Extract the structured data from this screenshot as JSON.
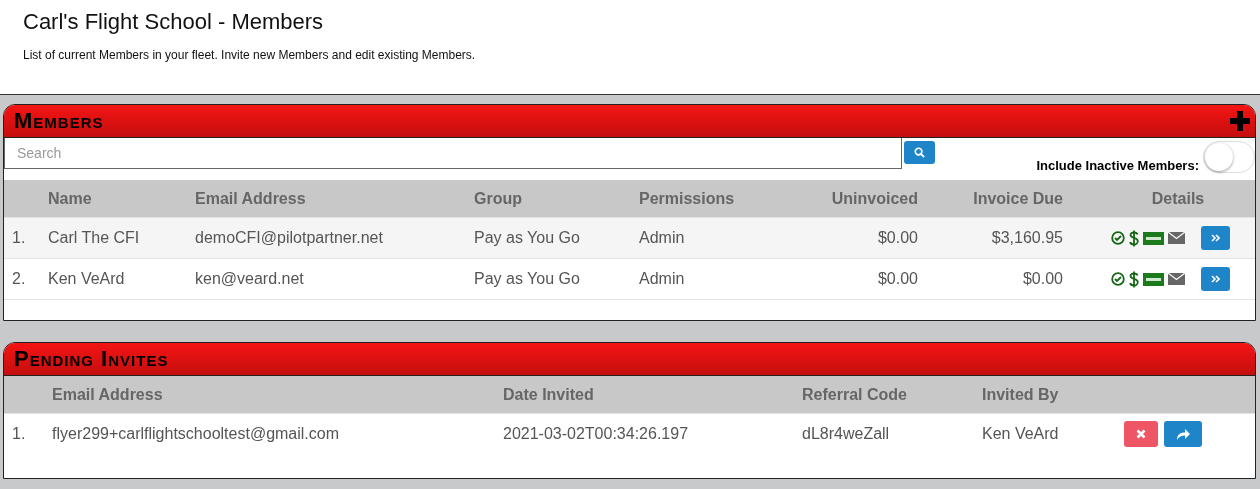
{
  "page": {
    "title": "Carl's Flight School - Members",
    "subtitle": "List of current Members in your fleet. Invite new Members and edit existing Members."
  },
  "members": {
    "title": "Members",
    "search": {
      "placeholder": "Search"
    },
    "include_inactive": {
      "label": "Include Inactive Members:",
      "on": false
    },
    "columns": [
      "Name",
      "Email Address",
      "Group",
      "Permissions",
      "Uninvoiced",
      "Invoice Due",
      "Details"
    ],
    "rows": [
      {
        "index": "1.",
        "name": "Carl The CFI",
        "email": "demoCFI@pilotpartner.net",
        "group": "Pay as You Go",
        "permissions": "Admin",
        "uninvoiced": "$0.00",
        "invoice_due": "$3,160.95"
      },
      {
        "index": "2.",
        "name": "Ken VeArd",
        "email": "ken@veard.net",
        "group": "Pay as You Go",
        "permissions": "Admin",
        "uninvoiced": "$0.00",
        "invoice_due": "$0.00"
      }
    ]
  },
  "pending_invites": {
    "title": "Pending Invites",
    "columns": [
      "Email Address",
      "Date Invited",
      "Referral Code",
      "Invited By"
    ],
    "rows": [
      {
        "index": "1.",
        "email": "flyer299+carlflightschooltest@gmail.com",
        "date_invited": "2021-03-02T00:34:26.197",
        "referral_code": "dL8r4weZall",
        "invited_by": "Ken VeArd"
      }
    ]
  }
}
